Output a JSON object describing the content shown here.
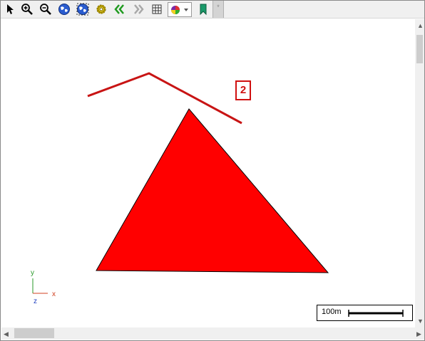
{
  "toolbar": {
    "tools": [
      {
        "name": "select-arrow-icon"
      },
      {
        "name": "zoom-in-icon"
      },
      {
        "name": "zoom-out-icon"
      },
      {
        "name": "globe-zoom-extent-icon"
      },
      {
        "name": "globe-zoom-layer-icon"
      },
      {
        "name": "settings-gear-icon"
      },
      {
        "name": "back-chevrons-icon"
      },
      {
        "name": "forward-chevrons-icon"
      },
      {
        "name": "grid-table-icon"
      },
      {
        "name": "layer-palette-dropdown-icon"
      },
      {
        "name": "bookmark-icon"
      }
    ],
    "tab_marker": "*"
  },
  "map": {
    "feature_label": "2",
    "fill_color": "#ff0000",
    "line_color": "#c81414"
  },
  "scale_bar": {
    "text": "100m"
  },
  "axes": {
    "x": "x",
    "y": "y",
    "z": "z"
  }
}
